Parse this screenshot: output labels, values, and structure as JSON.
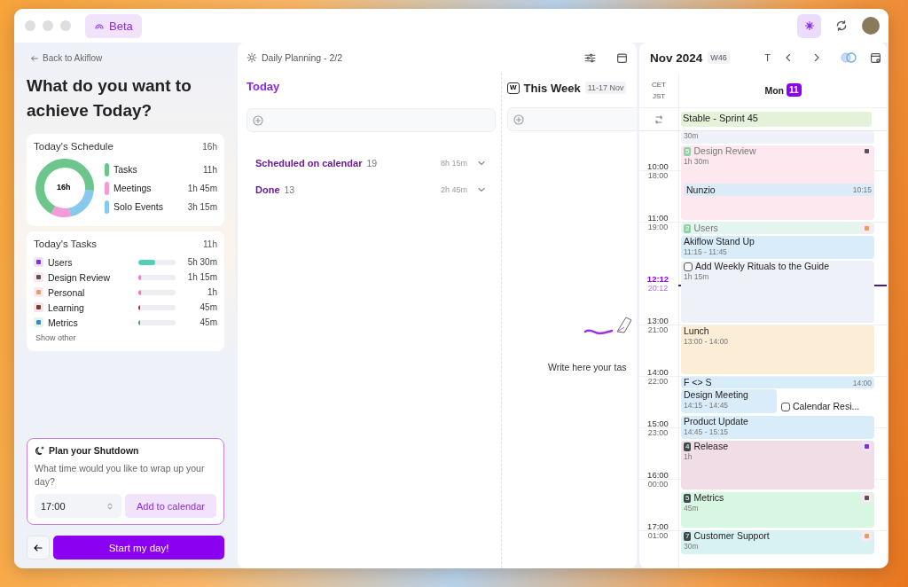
{
  "titlebar": {
    "badge": "Beta"
  },
  "left": {
    "back_link": "Back to Akiflow",
    "heading": "What do you want to achieve Today?",
    "schedule": {
      "title": "Today's Schedule",
      "total": "16h",
      "center_label": "16h",
      "chart_data": {
        "type": "donut",
        "values": [
          68.75,
          10.94,
          20.31
        ]
      },
      "legend": [
        {
          "label": "Tasks",
          "value": "11h",
          "color": "#6cc58b"
        },
        {
          "label": "Meetings",
          "value": "1h 45m",
          "color": "#f59ad9"
        },
        {
          "label": "Solo Events",
          "value": "3h 15m",
          "color": "#86c8ee"
        }
      ]
    },
    "tasks": {
      "title": "Today's Tasks",
      "total": "11h",
      "show_other": "Show other",
      "items": [
        {
          "label": "Users",
          "value": "5h 30m",
          "level": 0.45,
          "color": "#4fd1b5"
        },
        {
          "label": "Design Review",
          "value": "1h 15m",
          "level": 0.08,
          "color": "#f27bc0"
        },
        {
          "label": "Personal",
          "value": "1h",
          "level": 0.08,
          "color": "#f27bc0"
        },
        {
          "label": "Learning",
          "value": "45m",
          "level": 0.05,
          "color": "#b0245a"
        },
        {
          "label": "Metrics",
          "value": "45m",
          "level": 0.05,
          "color": "#2fb35a"
        }
      ]
    },
    "shutdown": {
      "title": "Plan your Shutdown",
      "question": "What time would you like to wrap up your day?",
      "time": "17:00",
      "add_button": "Add to calendar"
    },
    "start_button": "Start my day!"
  },
  "planning": {
    "title": "Daily Planning - 2/2",
    "today": {
      "title": "Today",
      "groups": [
        {
          "label": "Scheduled on calendar",
          "count": "19",
          "duration": "8h 15m",
          "expanded": false
        },
        {
          "label": "Done",
          "count": "13",
          "duration": "2h 45m",
          "expanded": false
        }
      ]
    },
    "week": {
      "badge": "W",
      "title": "This Week",
      "range": "11-17 Nov",
      "empty_text": "Write here your tas"
    }
  },
  "calendar": {
    "month": "Nov 2024",
    "week": "W46",
    "today_button": "T",
    "zones": [
      "CET",
      "JST"
    ],
    "day": {
      "name": "Mon",
      "number": "11",
      "selected": true
    },
    "all_day": [
      {
        "title": "Stable - Sprint 45",
        "color": "#e4f2d9"
      }
    ],
    "times": [
      {
        "kind": "hour",
        "primary": "10:00",
        "secondary": "18:00"
      },
      {
        "kind": "hour",
        "primary": "11:00",
        "secondary": "19:00"
      },
      {
        "kind": "now",
        "primary": "12:12",
        "secondary": "20:12"
      },
      {
        "kind": "hour",
        "primary": "13:00",
        "secondary": "21:00"
      },
      {
        "kind": "hour",
        "primary": "14:00",
        "secondary": "22:00"
      },
      {
        "kind": "hour",
        "primary": "15:00",
        "secondary": "23:00"
      },
      {
        "kind": "hour",
        "primary": "16:00",
        "secondary": "00:00"
      },
      {
        "kind": "hour",
        "primary": "17:00",
        "secondary": "01:00"
      }
    ],
    "events": [
      {
        "kind": "duration",
        "duration": "30m",
        "color": "#eef1f7"
      },
      {
        "kind": "block",
        "badge": "5",
        "title": "Design Review",
        "duration": "1h 30m",
        "color": "#fde8f0",
        "faded": true,
        "inner_events": [
          {
            "title": "Nunzio",
            "time": "10:15",
            "color": "#dcebf8"
          }
        ]
      },
      {
        "kind": "block",
        "badge": "2",
        "title": "Users",
        "color": "#e3f5ee",
        "faded": true
      },
      {
        "kind": "event",
        "title": "Akiflow Stand Up",
        "time": "11:15 - 11:45",
        "color": "#d9ecf9"
      },
      {
        "kind": "task",
        "title": "Add Weekly Rituals to the Guide",
        "duration": "1h 15m",
        "checked": false,
        "color": "#eef1f8"
      },
      {
        "kind": "event",
        "title": "Lunch",
        "time": "13:00 - 14:00",
        "color": "#fbedd6"
      },
      {
        "kind": "inline",
        "title": "F <> S",
        "time": "14:00",
        "color": "#d9ecf9"
      },
      {
        "kind": "event",
        "title": "Design Meeting",
        "time": "14:15 - 14:45",
        "color": "#d9ecf9"
      },
      {
        "kind": "task",
        "title": "Calendar Resi...",
        "checked": false,
        "color": "#ffffff"
      },
      {
        "kind": "event",
        "title": "Product Update",
        "time": "14:45 - 15:15",
        "color": "#d9ecf9"
      },
      {
        "kind": "block",
        "badge": "4",
        "title": "Release",
        "duration": "1h",
        "color": "#f1dde6",
        "faded": false
      },
      {
        "kind": "block",
        "badge": "5",
        "title": "Metrics",
        "duration": "45m",
        "color": "#d8f7e2",
        "faded": false
      },
      {
        "kind": "block",
        "badge": "7",
        "title": "Customer Support",
        "duration": "30m",
        "color": "#d8f1f2",
        "faded": false
      }
    ]
  }
}
